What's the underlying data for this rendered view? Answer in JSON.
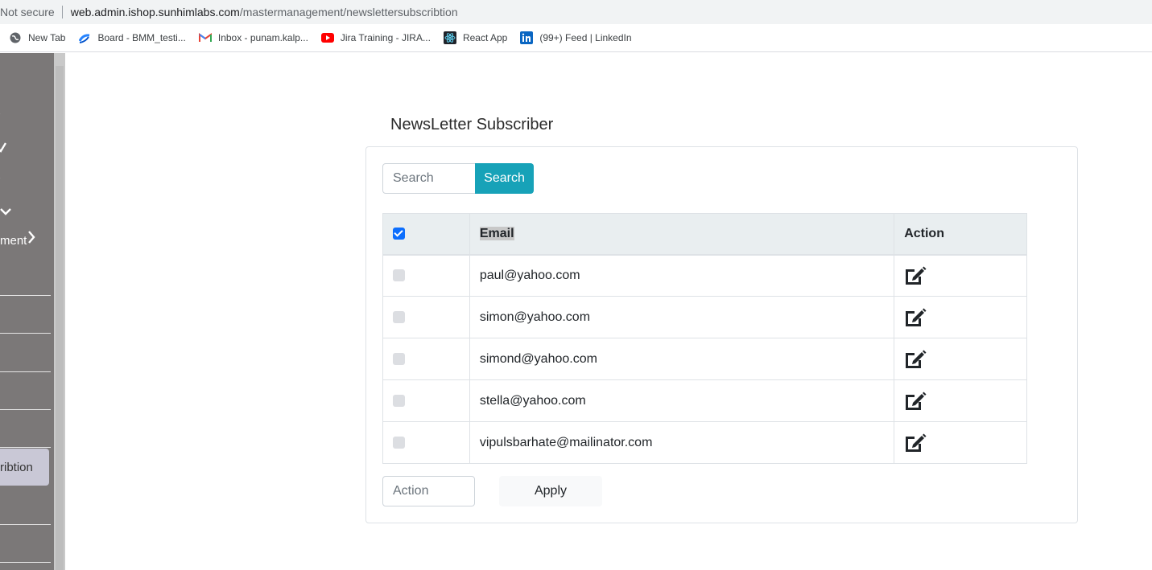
{
  "browser": {
    "security_label": "Not secure",
    "url_host": "web.admin.ishop.sunhimlabs.com",
    "url_path": "/mastermanagement/newslettersubscribtion",
    "bookmarks": [
      {
        "label": "New Tab",
        "icon": "globe-icon"
      },
      {
        "label": "Board - BMM_testi...",
        "icon": "confluence-icon"
      },
      {
        "label": "Inbox - punam.kalp...",
        "icon": "gmail-icon"
      },
      {
        "label": "Jira Training - JIRA...",
        "icon": "youtube-icon"
      },
      {
        "label": "React App",
        "icon": "react-icon"
      },
      {
        "label": "(99+) Feed | LinkedIn",
        "icon": "linkedin-icon"
      }
    ]
  },
  "sidebar": {
    "partial_label_1": "ment",
    "active_item_label": "ribtion"
  },
  "page": {
    "title": "NewsLetter Subscriber"
  },
  "search": {
    "placeholder": "Search",
    "button_label": "Search"
  },
  "table": {
    "headers": {
      "email": "Email",
      "action": "Action"
    },
    "header_checked": true,
    "rows": [
      {
        "email": "paul@yahoo.com"
      },
      {
        "email": "simon@yahoo.com"
      },
      {
        "email": "simond@yahoo.com"
      },
      {
        "email": "stella@yahoo.com"
      },
      {
        "email": "vipulsbarhate@mailinator.com"
      }
    ]
  },
  "bulk": {
    "action_placeholder": "Action",
    "apply_label": "Apply"
  },
  "colors": {
    "accent": "#17a2b8",
    "sidebar": "#7b7878",
    "checkbox_checked": "#0d6efd"
  }
}
